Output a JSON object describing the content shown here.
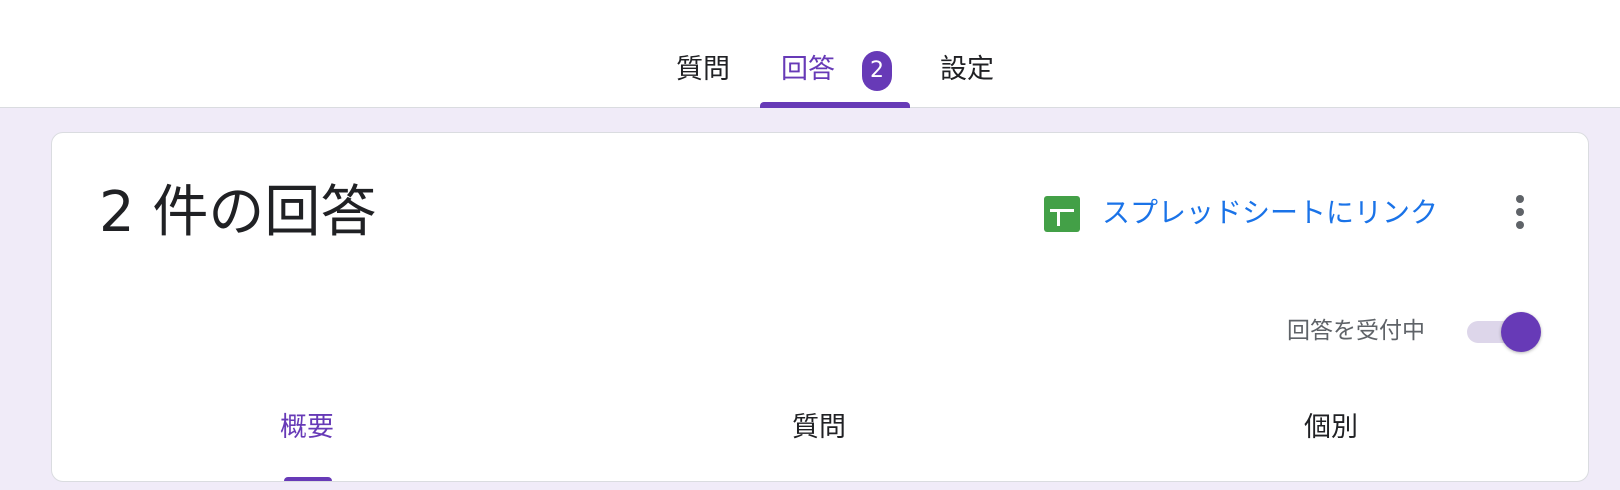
{
  "top_tabs": [
    {
      "label": "質問",
      "active": false
    },
    {
      "label": "回答",
      "active": true,
      "badge": "2"
    },
    {
      "label": "設定",
      "active": false
    }
  ],
  "responses": {
    "title": "2 件の回答",
    "sheets_link_label": "スプレッドシートにリンク",
    "sheets_icon": "google-sheets-icon",
    "more_icon": "more-vert-icon",
    "accepting_label": "回答を受付中",
    "accepting_on": true
  },
  "sub_tabs": [
    {
      "label": "概要",
      "active": true
    },
    {
      "label": "質問",
      "active": false
    },
    {
      "label": "個別",
      "active": false
    }
  ],
  "colors": {
    "accent": "#673ab7",
    "link": "#1a73e8",
    "background": "#f0ebf8",
    "sheets_green": "#43a047"
  }
}
